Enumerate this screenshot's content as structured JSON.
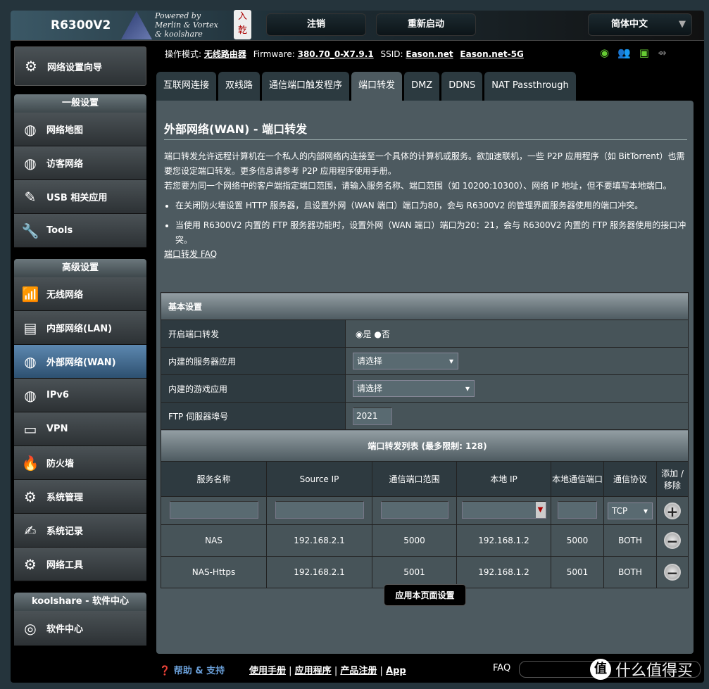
{
  "header": {
    "model": "R6300V2",
    "logo_text": [
      "Powered by",
      "Merlin & Vortex",
      "& koolshare"
    ],
    "seal": "入亁",
    "logout": "注销",
    "reboot": "重新启动",
    "language": "简体中文"
  },
  "status": {
    "mode_label": "操作模式:",
    "mode": "无线路由器",
    "fw_label": "Firmware:",
    "firmware": "380.70_0-X7.9.1",
    "ssid_label": "SSID:",
    "ssid1": "Eason.net",
    "ssid2": "Eason.net-5G",
    "icons": [
      "wifi-icon",
      "clients-icon",
      "lan-icon",
      "usb-icon"
    ]
  },
  "tabs": [
    "互联网连接",
    "双线路",
    "通信端口触发程序",
    "端口转发",
    "DMZ",
    "DDNS",
    "NAT Passthrough"
  ],
  "sidebar": {
    "wizard": "网络设置向导",
    "general_header": "一般设置",
    "general": [
      "网络地图",
      "访客网络",
      "USB 相关应用",
      "Tools"
    ],
    "advanced_header": "高级设置",
    "advanced": [
      "无线网络",
      "内部网络(LAN)",
      "外部网络(WAN)",
      "IPv6",
      "VPN",
      "防火墙",
      "系统管理",
      "系统记录",
      "网络工具"
    ],
    "kool_header": "koolshare - 软件中心",
    "kool": [
      "软件中心"
    ]
  },
  "main": {
    "title": "外部网络(WAN) - 端口转发",
    "desc1": "端口转发允许远程计算机在一个私人的内部网络内连接至一个具体的计算机或服务。欲加速联机，一些 P2P 应用程序（如 BitTorrent）也需要您设定端口转发。更多信息请参考 P2P 应用程序使用手册。",
    "desc2": "若您要为同一个网络中的客户端指定端口范围，请输入服务名称、端口范围（如 10200:10300）、网络 IP 地址，但不要填写本地端口。",
    "bullets": [
      "在关闭防火墙设置 HTTP 服务器，且设置外网（WAN 端口）端口为80，会与 R6300V2 的管理界面服务器使用的端口冲突。",
      "当使用 R6300V2 内置的 FTP 服务器功能时，设置外网（WAN 端口）端口为20：21，会与 R6300V2 内置的 FTP 服务器使用的接口冲突。"
    ],
    "faq": "端口转发 FAQ",
    "basic": {
      "header": "基本设置",
      "enable_label": "开启端口转发",
      "yes": "是",
      "no": "否",
      "enabled": true,
      "server_label": "内建的服务器应用",
      "server_value": "请选择",
      "game_label": "内建的游戏应用",
      "game_value": "请选择",
      "ftp_label": "FTP 伺服器埠号",
      "ftp_value": "2021"
    },
    "list": {
      "header": "端口转发列表 (最多限制:  128)",
      "columns": [
        "服务名称",
        "Source IP",
        "通信端口范围",
        "本地 IP",
        "本地通信端口",
        "通信协议",
        "添加 / 移除"
      ],
      "new_protocol": "TCP",
      "rows": [
        {
          "name": "NAS",
          "src": "192.168.2.1",
          "range": "5000",
          "ip": "192.168.1.2",
          "port": "5000",
          "proto": "BOTH"
        },
        {
          "name": "NAS-Https",
          "src": "192.168.2.1",
          "range": "5001",
          "ip": "192.168.1.2",
          "port": "5001",
          "proto": "BOTH"
        }
      ]
    },
    "apply": "应用本页面设置"
  },
  "footer": {
    "help": "帮助 & 支持",
    "links": [
      "使用手册",
      "应用程序",
      "产品注册",
      "App"
    ],
    "faq": "FAQ",
    "watermark": "什么值得买",
    "watermark_badge": "值"
  }
}
